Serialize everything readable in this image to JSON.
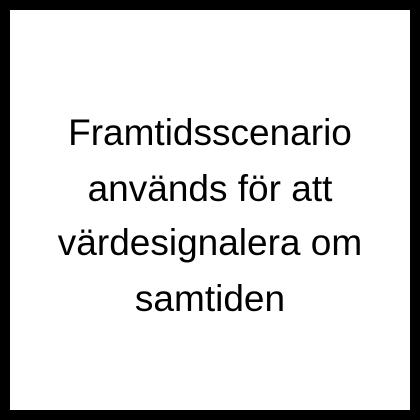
{
  "colors": {
    "frame": "#000000",
    "background": "#ffffff",
    "text": "#000000"
  },
  "text": {
    "lines": [
      "Framtidsscenario",
      "används för att",
      "värdesignalera om",
      "samtiden"
    ]
  }
}
